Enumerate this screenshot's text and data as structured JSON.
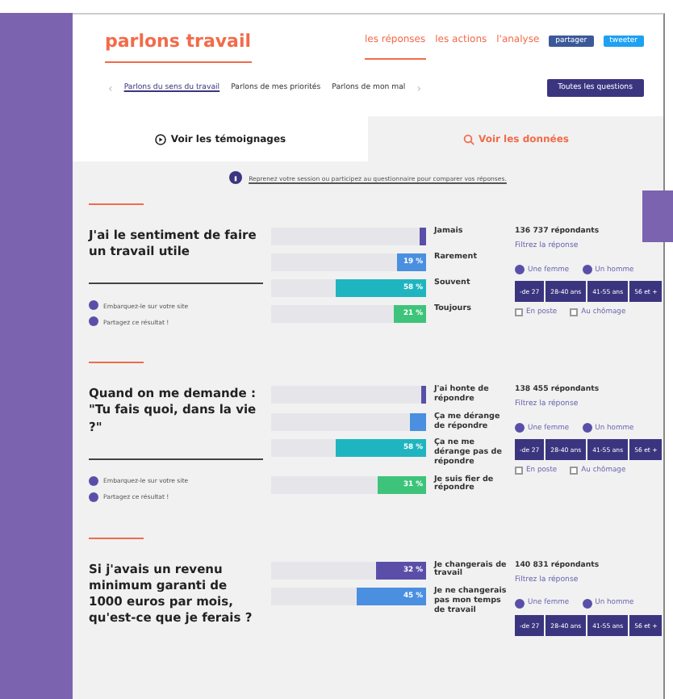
{
  "header": {
    "logo": "parlons travail",
    "nav": [
      {
        "label": "les réponses",
        "selected": true
      },
      {
        "label": "les actions",
        "selected": false
      },
      {
        "label": "l'analyse",
        "selected": false
      }
    ],
    "share": [
      {
        "kind": "facebook",
        "label": "partager"
      },
      {
        "kind": "twitter",
        "label": "tweeter"
      }
    ]
  },
  "subnav": {
    "prev": "‹",
    "items": [
      {
        "label": "Parlons du sens du travail",
        "selected": true
      },
      {
        "label": "Parlons de mes priorités",
        "selected": false
      },
      {
        "label": "Parlons de mon mal",
        "selected": false
      }
    ],
    "next": "›",
    "all_button": "Toutes les questions"
  },
  "tabs": [
    {
      "label": "Voir les témoignages",
      "kind": "testimonies",
      "selected": true
    },
    {
      "label": "Voir les données",
      "kind": "data",
      "selected": false
    }
  ],
  "notice": "Reprenez votre session ou participez au questionnaire pour comparer vos réponses.",
  "questions": [
    {
      "title": "J'ai le sentiment de faire un travail utile",
      "embed": "Embarquez-le sur votre site",
      "share": "Partagez ce résultat !",
      "answers": [
        {
          "label": "Jamais",
          "level": 0.04,
          "color": "#5a4fa8"
        },
        {
          "label": "Rarement",
          "level": 0.19,
          "value": "19 %",
          "color": "#4a8fe0"
        },
        {
          "label": "Souvent",
          "level": 0.58,
          "value": "58 %",
          "color": "#1fb5c0"
        },
        {
          "label": "Toujours",
          "level": 0.21,
          "value": "21 %",
          "color": "#3ec47a"
        }
      ],
      "respondents": "136 737 répondants",
      "filter": "Filtrez la réponse",
      "genders": [
        {
          "label": "Une femme",
          "checked": true
        },
        {
          "label": "Un homme",
          "checked": true
        }
      ],
      "ages": [
        "-de 27",
        "28-40 ans",
        "41-55 ans",
        "56 et +"
      ],
      "statuses": [
        {
          "label": "En poste",
          "checked": false
        },
        {
          "label": "Au chômage",
          "checked": false
        }
      ]
    },
    {
      "title": "Quand on me demande : \"Tu fais quoi, dans la vie ?\"",
      "embed": "Embarquez-le sur votre site",
      "share": "Partagez ce résultat !",
      "answers": [
        {
          "label": "J'ai honte de répondre",
          "level": 0.03,
          "color": "#5a4fa8"
        },
        {
          "label": "Ça me dérange de répondre",
          "level": 0.1,
          "color": "#4a8fe0"
        },
        {
          "label": "Ça ne me dérange pas de répondre",
          "level": 0.58,
          "value": "58 %",
          "color": "#1fb5c0"
        },
        {
          "label": "Je suis fier de répondre",
          "level": 0.31,
          "value": "31 %",
          "color": "#3ec47a"
        }
      ],
      "respondents": "138 455 répondants",
      "filter": "Filtrez la réponse",
      "genders": [
        {
          "label": "Une femme",
          "checked": true
        },
        {
          "label": "Un homme",
          "checked": true
        }
      ],
      "ages": [
        "-de 27",
        "28-40 ans",
        "41-55 ans",
        "56 et +"
      ],
      "statuses": [
        {
          "label": "En poste",
          "checked": false
        },
        {
          "label": "Au chômage",
          "checked": false
        }
      ]
    },
    {
      "title": "Si j'avais un revenu minimum garanti de 1000 euros par mois, qu'est-ce que je ferais ?",
      "answers": [
        {
          "label": "Je changerais de travail",
          "level": 0.32,
          "value": "32 %",
          "color": "#5a4fa8"
        },
        {
          "label": "Je ne changerais pas mon temps de travail",
          "level": 0.45,
          "value": "45 %",
          "color": "#4a8fe0"
        }
      ],
      "respondents": "140 831 répondants",
      "filter": "Filtrez la réponse",
      "genders": [
        {
          "label": "Une femme",
          "checked": true
        },
        {
          "label": "Un homme",
          "checked": true
        }
      ],
      "ages": [
        "-de 27",
        "28-40 ans",
        "41-55 ans",
        "56 et +"
      ]
    }
  ]
}
